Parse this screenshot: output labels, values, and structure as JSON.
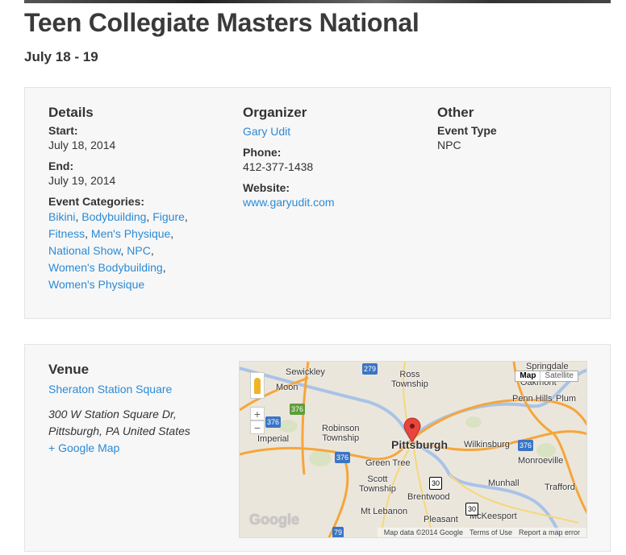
{
  "event": {
    "title": "Teen Collegiate Masters National",
    "date": "July 18 - 19"
  },
  "details": {
    "heading": "Details",
    "start_label": "Start:",
    "start": "July 18, 2014",
    "end_label": "End:",
    "end": "July 19, 2014",
    "categories_label": "Event Categories:",
    "categories": [
      "Bikini",
      "Bodybuilding",
      "Figure",
      "Fitness",
      "Men's Physique",
      "National Show",
      "NPC",
      "Women's Bodybuilding",
      "Women's Physique"
    ]
  },
  "organizer": {
    "heading": "Organizer",
    "name": "Gary Udit",
    "phone_label": "Phone:",
    "phone": "412-377-1438",
    "website_label": "Website:",
    "website": "www.garyudit.com"
  },
  "other": {
    "heading": "Other",
    "type_label": "Event Type",
    "type": "NPC"
  },
  "venue": {
    "heading": "Venue",
    "name": "Sheraton Station Square",
    "address1": "300 W Station Square Dr,",
    "address2": "Pittsburgh, PA United States",
    "map_link": "+ Google Map"
  },
  "map": {
    "type_map": "Map",
    "type_satellite": "Satellite",
    "zoom_in": "+",
    "zoom_out": "−",
    "attribution": "Map data ©2014 Google",
    "terms": "Terms of Use",
    "report": "Report a map error",
    "logo": "Google",
    "labels": [
      "Sewickley",
      "Moon",
      "Ross Township",
      "Oakmont",
      "Penn Hills",
      "Plum",
      "Robinson Township",
      "Imperial",
      "Pittsburgh",
      "Wilkinsburg",
      "Green Tree",
      "Monroeville",
      "Scott Township",
      "Munhall",
      "Trafford",
      "Brentwood",
      "Mt Lebanon",
      "Pleasant",
      "McKeesport",
      "Springdale"
    ],
    "shields": [
      "279",
      "376",
      "376",
      "376",
      "376",
      "30",
      "30",
      "79"
    ]
  }
}
